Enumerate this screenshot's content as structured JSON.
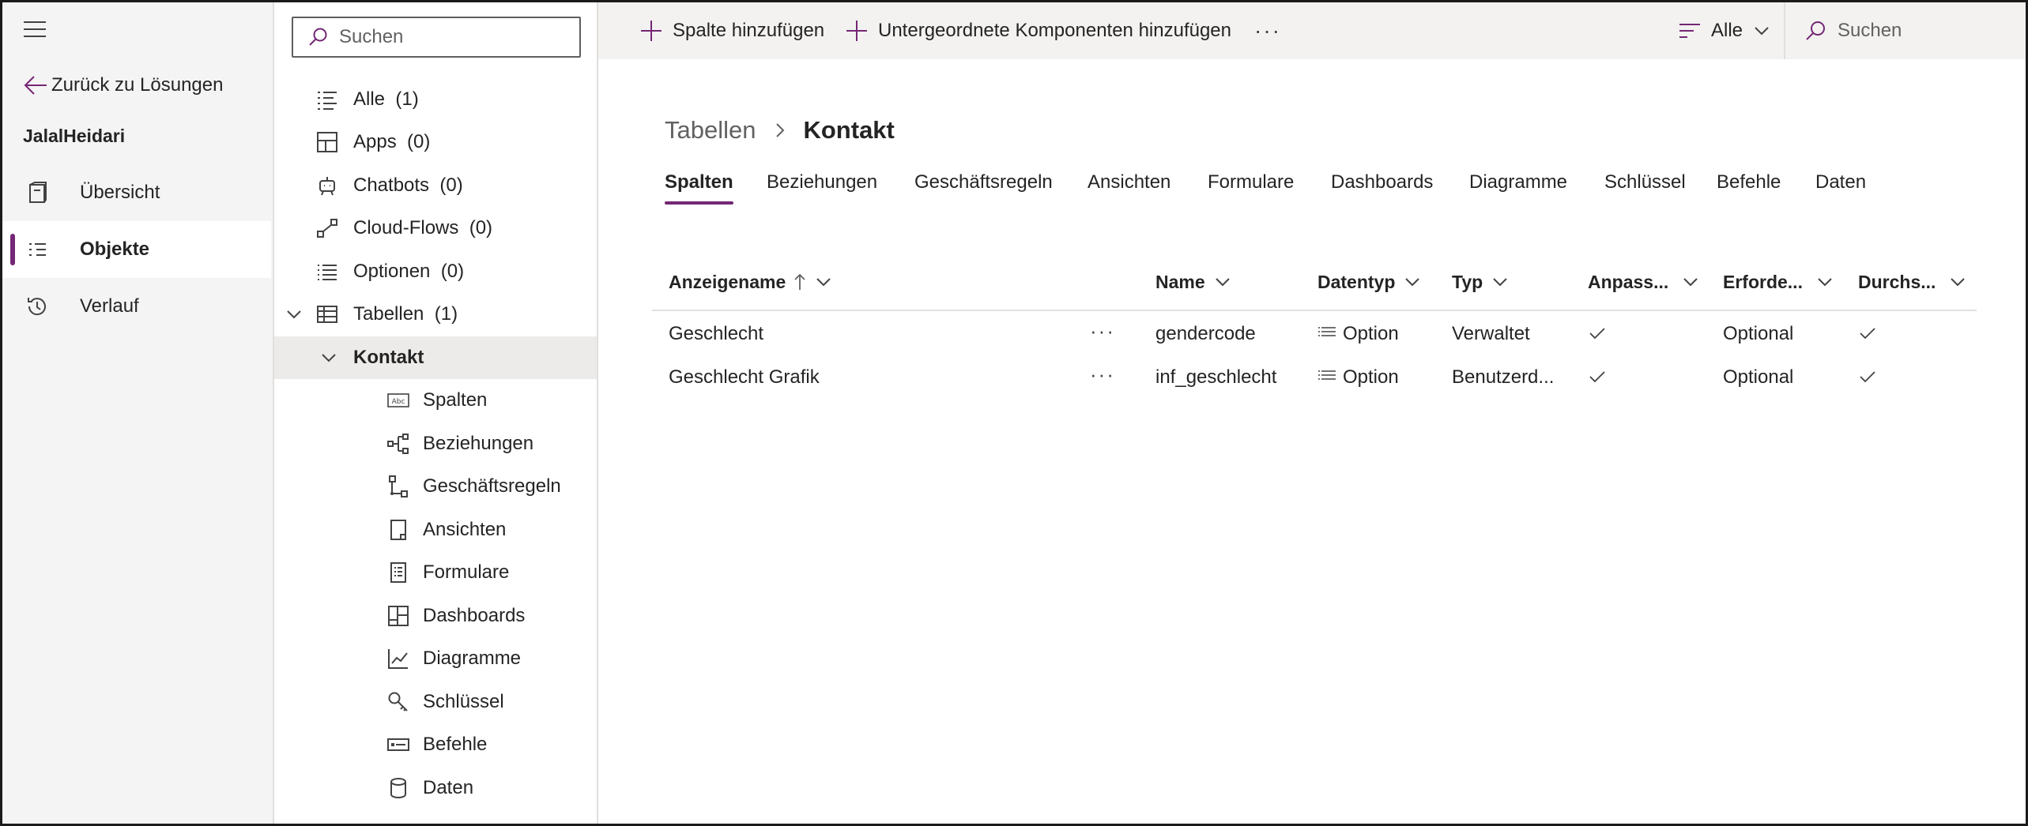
{
  "nav": {
    "back_label": "Zurück zu Lösungen",
    "solution_name": "JalalHeidari",
    "items": [
      {
        "label": "Übersicht",
        "icon": "overview-icon"
      },
      {
        "label": "Objekte",
        "icon": "objects-list-icon",
        "active": true
      },
      {
        "label": "Verlauf",
        "icon": "history-icon"
      }
    ]
  },
  "tree": {
    "search_placeholder": "Suchen",
    "items": [
      {
        "label": "Alle",
        "count": "(1)",
        "icon": "list-icon"
      },
      {
        "label": "Apps",
        "count": "(0)",
        "icon": "apps-icon"
      },
      {
        "label": "Chatbots",
        "count": "(0)",
        "icon": "chatbot-icon"
      },
      {
        "label": "Cloud-Flows",
        "count": "(0)",
        "icon": "flow-icon"
      },
      {
        "label": "Optionen",
        "count": "(0)",
        "icon": "options-icon"
      },
      {
        "label": "Tabellen",
        "count": "(1)",
        "icon": "table-icon",
        "expanded": true
      },
      {
        "label": "Kontakt",
        "selected": true,
        "expanded": true
      },
      {
        "label": "Spalten",
        "icon": "text-field-icon"
      },
      {
        "label": "Beziehungen",
        "icon": "relationships-icon"
      },
      {
        "label": "Geschäftsregeln",
        "icon": "business-rules-icon"
      },
      {
        "label": "Ansichten",
        "icon": "view-icon"
      },
      {
        "label": "Formulare",
        "icon": "form-icon"
      },
      {
        "label": "Dashboards",
        "icon": "dashboard-icon"
      },
      {
        "label": "Diagramme",
        "icon": "chart-icon"
      },
      {
        "label": "Schlüssel",
        "icon": "key-icon"
      },
      {
        "label": "Befehle",
        "icon": "command-icon"
      },
      {
        "label": "Daten",
        "icon": "database-icon"
      }
    ]
  },
  "commandbar": {
    "add_column": "Spalte hinzufügen",
    "add_subcomponents": "Untergeordnete Komponenten hinzufügen",
    "more": "···",
    "filter_label": "Alle",
    "search_placeholder": "Suchen"
  },
  "breadcrumb": {
    "parent": "Tabellen",
    "current": "Kontakt"
  },
  "tabs": [
    "Spalten",
    "Beziehungen",
    "Geschäftsregeln",
    "Ansichten",
    "Formulare",
    "Dashboards",
    "Diagramme",
    "Schlüssel",
    "Befehle",
    "Daten"
  ],
  "table": {
    "columns": [
      "Anzeigename",
      "Name",
      "Datentyp",
      "Typ",
      "Anpass...",
      "Erforde...",
      "Durchs..."
    ],
    "rows": [
      {
        "display_name": "Geschlecht",
        "name": "gendercode",
        "datatype": "Option",
        "type": "Verwaltet",
        "customizable": true,
        "required": "Optional",
        "searchable": true
      },
      {
        "display_name": "Geschlecht Grafik",
        "name": "inf_geschlecht",
        "datatype": "Option",
        "type": "Benutzerd...",
        "customizable": true,
        "required": "Optional",
        "searchable": true
      }
    ],
    "row_more": "···"
  },
  "colors": {
    "accent": "#742774",
    "nav_bg": "#f5f4f4",
    "commandbar_bg": "#f3f2f1",
    "selected_bg": "#edebe9"
  }
}
